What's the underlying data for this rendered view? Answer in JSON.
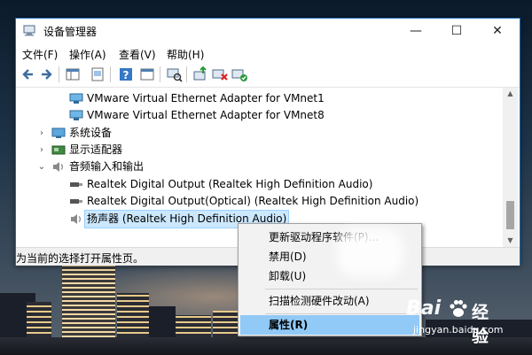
{
  "window": {
    "title": "设备管理器",
    "minimize": "—",
    "maximize": "☐",
    "close": "✕"
  },
  "menubar": [
    "文件(F)",
    "操作(A)",
    "查看(V)",
    "帮助(H)"
  ],
  "tree": [
    {
      "label": "VMware Virtual Ethernet Adapter for VMnet1",
      "icon": "network-adapter-icon"
    },
    {
      "label": "VMware Virtual Ethernet Adapter for VMnet8",
      "icon": "network-adapter-icon"
    },
    {
      "label": "系统设备",
      "icon": "system-devices-icon",
      "expander": "›"
    },
    {
      "label": "显示适配器",
      "icon": "display-adapter-icon",
      "expander": "›"
    },
    {
      "label": "音频输入和输出",
      "icon": "speaker-icon",
      "expander": "⌄"
    },
    {
      "label": "Realtek Digital Output (Realtek High Definition Audio)",
      "icon": "audio-output-icon"
    },
    {
      "label": "Realtek Digital Output(Optical) (Realtek High Definition Audio)",
      "icon": "audio-output-icon"
    },
    {
      "label": "扬声器 (Realtek High Definition Audio)",
      "icon": "speaker-icon"
    }
  ],
  "status": "为当前的选择打开属性页。",
  "context_menu": {
    "update_driver": "更新驱动程序软件(P)...",
    "disable": "禁用(D)",
    "uninstall": "卸载(U)",
    "scan": "扫描检测硬件改动(A)",
    "properties": "属性(R)"
  },
  "watermark": {
    "brand_bai": "Bai",
    "brand_jingyan": "经验",
    "url": "jingyan.baidu.com"
  },
  "colors": {
    "accent": "#1c6bb6",
    "selection": "#cce8ff",
    "menu_highlight": "#91c9f7"
  }
}
